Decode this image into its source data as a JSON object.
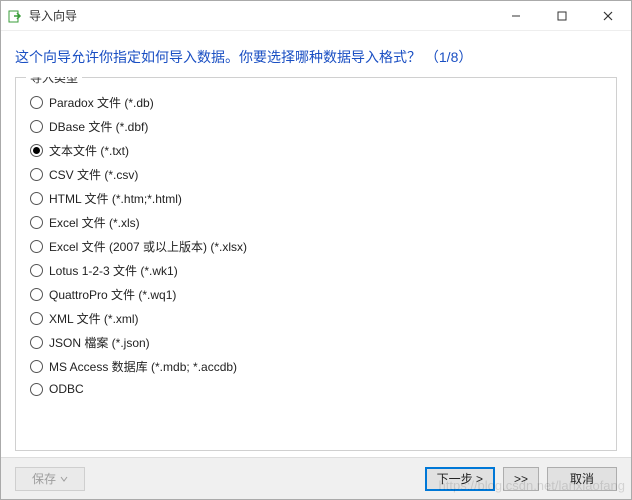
{
  "titlebar": {
    "title": "导入向导"
  },
  "header": {
    "prompt": "这个向导允许你指定如何导入数据。你要选择哪种数据导入格式？ （1/8）"
  },
  "group": {
    "legend": "导入类型"
  },
  "options": [
    {
      "label": "Paradox 文件 (*.db)",
      "selected": false
    },
    {
      "label": "DBase 文件 (*.dbf)",
      "selected": false
    },
    {
      "label": "文本文件 (*.txt)",
      "selected": true
    },
    {
      "label": "CSV 文件 (*.csv)",
      "selected": false
    },
    {
      "label": "HTML 文件 (*.htm;*.html)",
      "selected": false
    },
    {
      "label": "Excel 文件 (*.xls)",
      "selected": false
    },
    {
      "label": "Excel 文件 (2007 或以上版本) (*.xlsx)",
      "selected": false
    },
    {
      "label": "Lotus 1-2-3 文件 (*.wk1)",
      "selected": false
    },
    {
      "label": "QuattroPro 文件 (*.wq1)",
      "selected": false
    },
    {
      "label": "XML 文件 (*.xml)",
      "selected": false
    },
    {
      "label": "JSON 檔案 (*.json)",
      "selected": false
    },
    {
      "label": "MS Access 数据库 (*.mdb; *.accdb)",
      "selected": false
    },
    {
      "label": "ODBC",
      "selected": false
    }
  ],
  "footer": {
    "save": "保存",
    "next": "下一步 >",
    "skipfwd": ">>",
    "cancel": "取消"
  },
  "watermark": "https://blog.csdn.net/lanxiaofang"
}
